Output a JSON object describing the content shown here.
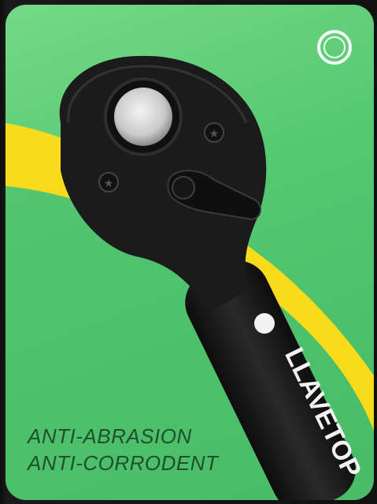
{
  "product": {
    "brand": "LLAVETOP",
    "features": [
      "ANTI-ABRASION",
      "ANTI-CORRODENT"
    ]
  },
  "colors": {
    "card_green": "#56c872",
    "stripe_yellow": "#f8dc1c",
    "tool_black": "#1b1b1b",
    "caption_text": "#1f4f2d"
  },
  "icons": {
    "corner_button": "circle-outline-icon"
  }
}
